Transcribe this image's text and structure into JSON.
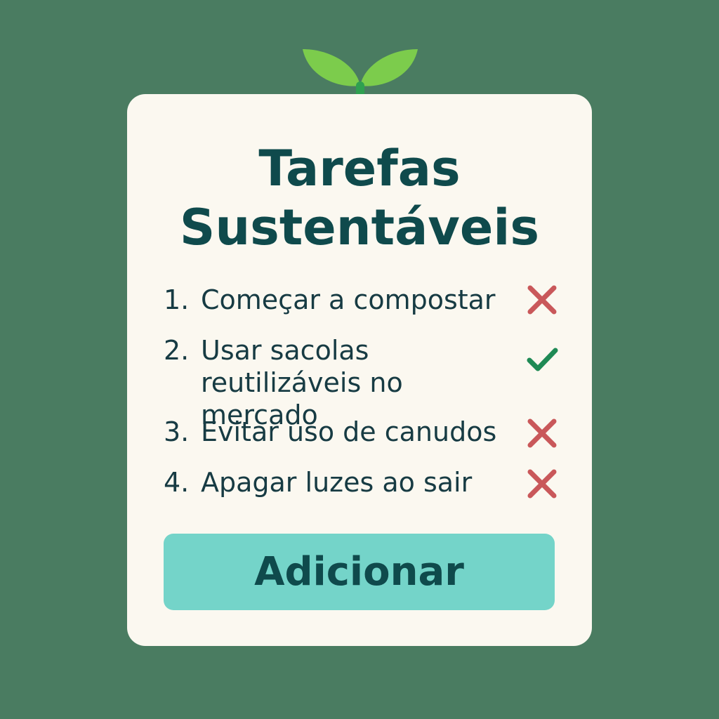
{
  "app": {
    "title_line1": "Tarefas",
    "title_line2": "Sustentáveis"
  },
  "tasks": [
    {
      "number": "1.",
      "label": "Começar a compostar",
      "status": "x-icon",
      "done": false
    },
    {
      "number": "2.",
      "label": "Usar sacolas reutilizáveis no mercado",
      "status": "check-icon",
      "done": true
    },
    {
      "number": "3.",
      "label": "Evitar uso de canudos",
      "status": "x-icon",
      "done": false
    },
    {
      "number": "4.",
      "label": "Apagar luzes ao sair",
      "status": "x-icon",
      "done": false
    }
  ],
  "actions": {
    "add_label": "Adicionar"
  },
  "colors": {
    "background": "#4a7c61",
    "card": "#fbf8f0",
    "title": "#0f4a4c",
    "text": "#173b43",
    "button": "#74d4c9",
    "x_mark": "#c9585a",
    "check_mark": "#1f8a55",
    "leaf": "#7ccc4c",
    "stem": "#2fa050"
  },
  "icons": {
    "logo": "sprout-icon",
    "pending": "x-icon",
    "done": "check-icon"
  }
}
